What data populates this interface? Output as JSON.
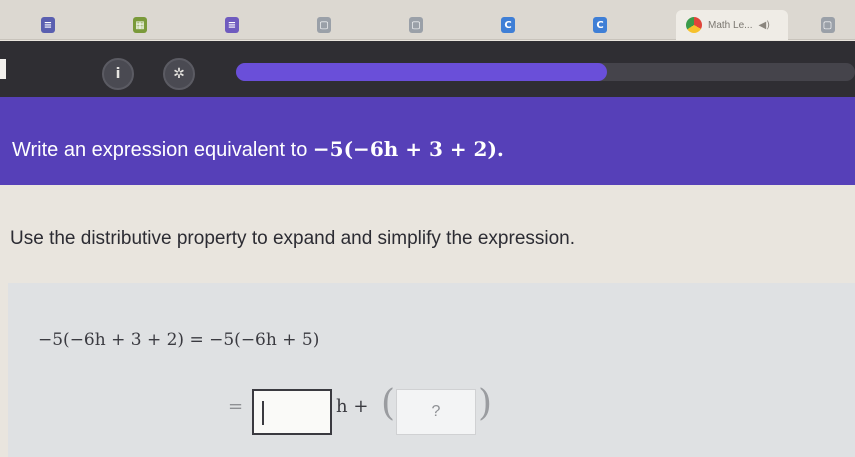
{
  "browser": {
    "tabs": [
      {
        "icon": "list-doc-icon",
        "color": "#5a5fb0",
        "glyph": "≡"
      },
      {
        "icon": "classroom-icon",
        "color": "#7a9a3a",
        "glyph": "▦"
      },
      {
        "icon": "forms-icon",
        "color": "#6f5bbf",
        "glyph": "≡"
      },
      {
        "icon": "slides-icon",
        "color": "#9aa0a8",
        "glyph": "▢"
      },
      {
        "icon": "slides-icon",
        "color": "#9aa0a8",
        "glyph": "▢"
      },
      {
        "icon": "c-app-icon",
        "color": "#3f7fd6",
        "glyph": "C"
      },
      {
        "icon": "c-app-icon",
        "color": "#3f7fd6",
        "glyph": "C"
      }
    ],
    "active_tab": {
      "title": "Math Le...",
      "icon": "chrome-logo-icon",
      "sound_icon": "speaker-icon",
      "sound_glyph": "◀)"
    },
    "trailing_icon": "slides-icon",
    "trailing_glyph": "▢"
  },
  "toolbar": {
    "info_glyph": "i",
    "settings_glyph": "✲",
    "progress_fraction": 0.6
  },
  "question": {
    "prompt": "Write an expression equivalent to",
    "expression": "−5(−6h + 3 + 2)."
  },
  "instruction": "Use the distributive property to expand and simplify the expression.",
  "work": {
    "line1": "−5(−6h + 3 + 2) = −5(−6h + 5)",
    "equals": "=",
    "variable_plus": "h +",
    "box2_placeholder": "?",
    "open_paren": "(",
    "close_paren": ")"
  },
  "colors": {
    "banner": "#5640b8",
    "toolbar": "#2f2e33",
    "progress": "#6a4fd9"
  }
}
